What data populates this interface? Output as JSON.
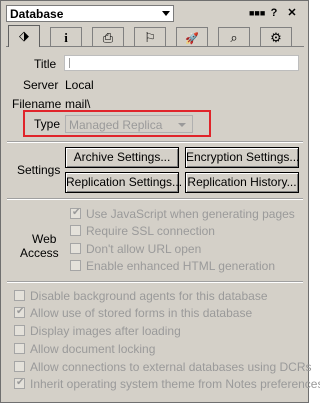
{
  "header": {
    "title": "Database",
    "info_mini_glyph": "■■■",
    "help_glyph": "?",
    "close_glyph": "✕"
  },
  "tabs": [
    {
      "name": "database-basics",
      "glyph": "⬗"
    },
    {
      "name": "info",
      "glyph": "i"
    },
    {
      "name": "printer",
      "glyph": "⎙"
    },
    {
      "name": "design",
      "glyph": "⚐"
    },
    {
      "name": "launch",
      "glyph": "🚀"
    },
    {
      "name": "full-text-search",
      "glyph": "⌕"
    },
    {
      "name": "advanced",
      "glyph": "⚙"
    }
  ],
  "basics": {
    "title_label": "Title",
    "title_value": "",
    "server_label": "Server",
    "server_value": "Local",
    "filename_label": "Filename",
    "filename_value": "mail\\",
    "type_label": "Type",
    "type_value": "Managed Replica"
  },
  "settings": {
    "label": "Settings",
    "buttons": {
      "archive": "Archive Settings...",
      "encryption": "Encryption Settings...",
      "replication": "Replication Settings...",
      "replication_history": "Replication History..."
    }
  },
  "web_access": {
    "label_line1": "Web",
    "label_line2": "Access",
    "options": [
      {
        "label": "Use JavaScript when generating pages",
        "checked": true
      },
      {
        "label": "Require SSL connection",
        "checked": false
      },
      {
        "label": "Don't allow URL open",
        "checked": false
      },
      {
        "label": "Enable enhanced HTML generation",
        "checked": false
      }
    ]
  },
  "general_options": [
    {
      "label": "Disable background agents for this database",
      "checked": false
    },
    {
      "label": "Allow use of stored forms in this database",
      "checked": true
    },
    {
      "label": "Display images after loading",
      "checked": false
    },
    {
      "label": "Allow document locking",
      "checked": false
    },
    {
      "label": "Allow connections to external databases using DCRs",
      "checked": false
    },
    {
      "label": "Inherit operating system theme from Notes preferences",
      "checked": true
    }
  ],
  "check_glyph": "✔",
  "colors": {
    "dialog_bg": "#d4d0c8",
    "highlight_border": "#e0242a",
    "disabled_text": "#9a9a9a"
  }
}
